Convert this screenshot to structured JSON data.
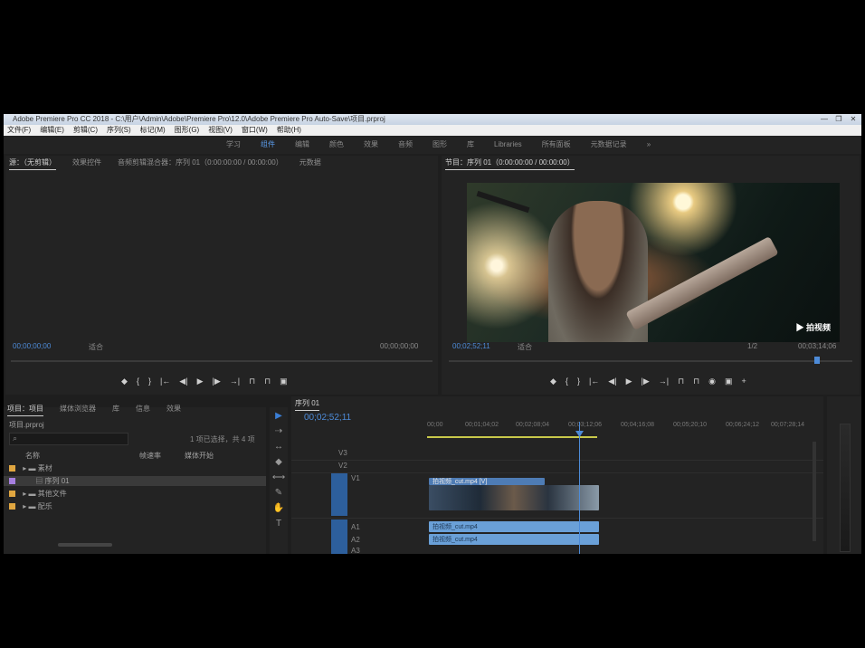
{
  "titlebar": {
    "text": "Adobe Premiere Pro CC 2018 - C:\\用户\\Admin\\Adobe\\Premiere Pro\\12.0\\Adobe Premiere Pro Auto-Save\\项目.prproj"
  },
  "window_controls": [
    "—",
    "❐",
    "✕"
  ],
  "menu": [
    "文件(F)",
    "编辑(E)",
    "剪辑(C)",
    "序列(S)",
    "标记(M)",
    "图形(G)",
    "视图(V)",
    "窗口(W)",
    "帮助(H)"
  ],
  "workspaces": {
    "items": [
      "学习",
      "组件",
      "编辑",
      "颜色",
      "效果",
      "音频",
      "图形",
      "库",
      "Libraries",
      "所有面板",
      "元数据记录"
    ],
    "active_index": 1,
    "more": "»"
  },
  "source_panel": {
    "tabs": [
      "源：（无剪辑）",
      "效果控件",
      "音频剪辑混合器：序列 01（0:00:00:00 / 00:00:00）",
      "元数据"
    ],
    "timecode_left": "00;00;00;00",
    "fit": "适合",
    "timecode_right": "00;00;00;00"
  },
  "program_panel": {
    "tab": "节目：序列 01（0:00:00:00 / 00:00:00）",
    "timecode_left": "00;02;52;11",
    "fit": "适合",
    "zoom": "1/2",
    "timecode_right": "00;03;14;06",
    "watermark": "▶ 拍视频"
  },
  "transport_controls": [
    "◆",
    "{",
    "}",
    "|←",
    "◀|",
    "▶",
    "|▶",
    "→|",
    "⊓",
    "⊓",
    "◉",
    "▣",
    "⌂",
    "+"
  ],
  "project_panel": {
    "tabs": [
      "项目：项目",
      "媒体浏览器",
      "库",
      "信息",
      "效果"
    ],
    "project_name": "项目.prproj",
    "search_placeholder": "",
    "count": "1 项已选择，共 4 项",
    "columns": [
      "名称",
      "帧速率",
      "媒体开始"
    ],
    "items": [
      {
        "label": "素材",
        "color": "#e0a640"
      },
      {
        "label": "序列 01",
        "color": "#a67fe0"
      },
      {
        "label": "其他文件",
        "color": "#e0a640"
      },
      {
        "label": "配乐",
        "color": "#e0a640"
      }
    ]
  },
  "tools": [
    "▶",
    "⇢",
    "↔",
    "◆",
    "⟷",
    "✎",
    "✋",
    "T"
  ],
  "timeline": {
    "tab": "序列 01",
    "timecode": "00;02;52;11",
    "ruler_labels": [
      "00;00",
      "00;01;04;02",
      "00;02;08;04",
      "00;03;12;06",
      "00;04;16;08",
      "00;05;20;10",
      "00;06;24;12",
      "00;07;28;14"
    ],
    "tracks": [
      "V3",
      "V2",
      "V1",
      "A1",
      "A2",
      "A3"
    ],
    "video_clip_label": "拍视频_cut.mp4 [V]",
    "audio_clip_label": "拍视频_cut.mp4"
  },
  "colors": {
    "accent": "#4d8bd8",
    "clip_video": "#4e7cb5",
    "clip_audio": "#6aa0d8",
    "panel": "#232323"
  }
}
